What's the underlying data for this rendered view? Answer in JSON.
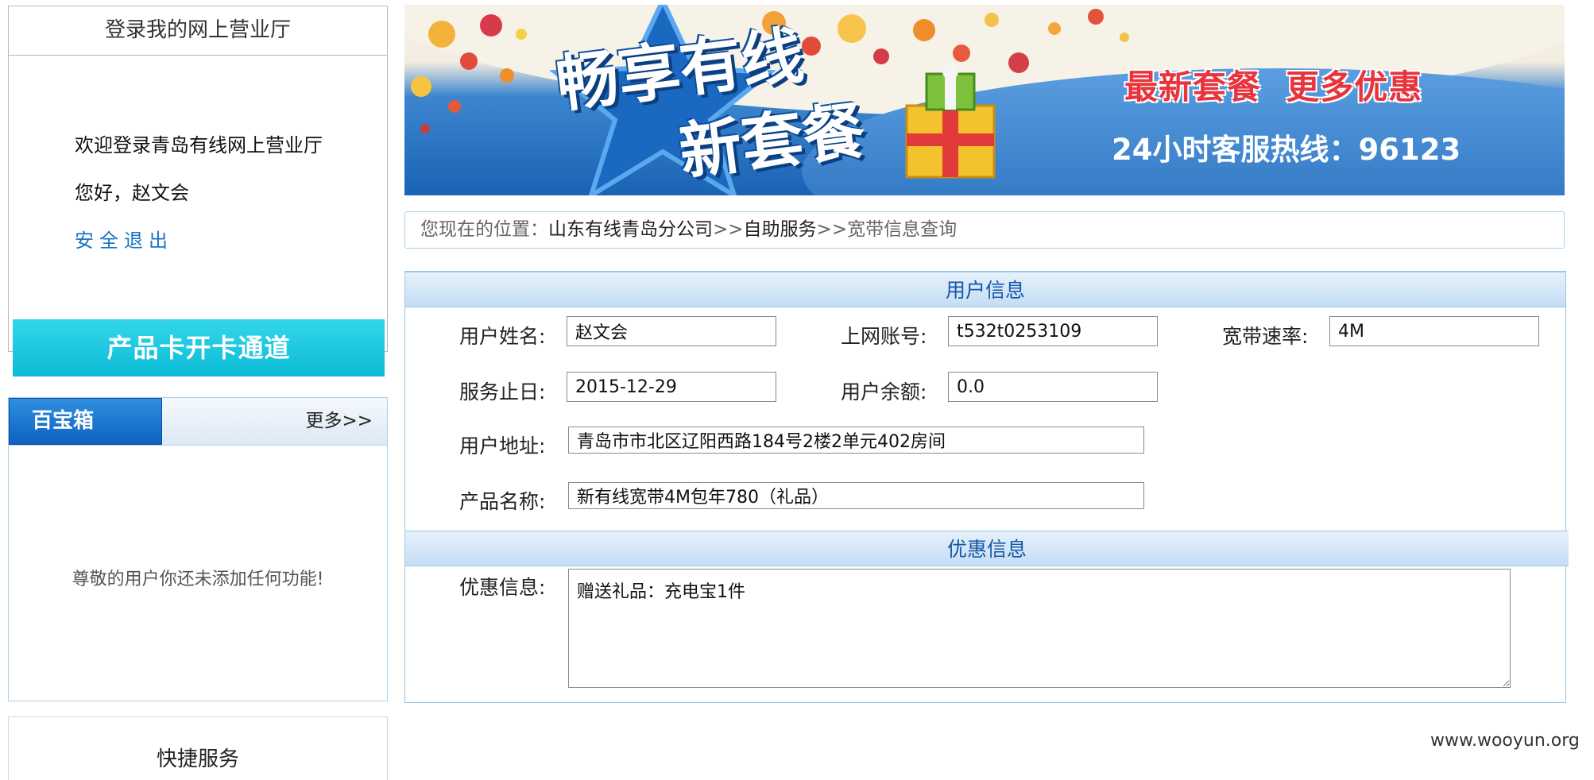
{
  "sidebar": {
    "login": {
      "title": "登录我的网上营业厅",
      "welcome": "欢迎登录青岛有线网上营业厅",
      "greeting": "您好，赵文会",
      "logout": "安全退出",
      "card_button": "产品卡开卡通道"
    },
    "toolbox": {
      "tab": "百宝箱",
      "more": "更多>>",
      "empty_message": "尊敬的用户你还未添加任何功能!"
    },
    "quick_service": {
      "title": "快捷服务"
    }
  },
  "banner": {
    "title_line1": "畅享有线",
    "title_line2": "新套餐",
    "promo": "最新套餐  更多优惠",
    "hotline": "24小时客服热线：96123"
  },
  "breadcrumb": {
    "prefix": "您现在的位置：",
    "items": [
      "山东有线青岛分公司",
      "自助服务",
      "宽带信息查询"
    ],
    "separator": ">>"
  },
  "user_info": {
    "heading": "用户信息",
    "fields": {
      "name": {
        "label": "用户姓名:",
        "value": "赵文会"
      },
      "account": {
        "label": "上网账号:",
        "value": "t532t0253109"
      },
      "speed": {
        "label": "宽带速率:",
        "value": "4M"
      },
      "expiry": {
        "label": "服务止日:",
        "value": "2015-12-29"
      },
      "balance": {
        "label": "用户余额:",
        "value": "0.0"
      },
      "address": {
        "label": "用户地址:",
        "value": "青岛市市北区辽阳西路184号2楼2单元402房间"
      },
      "product": {
        "label": "产品名称:",
        "value": "新有线宽带4M包年780（礼品）"
      }
    }
  },
  "promo_info": {
    "heading": "优惠信息",
    "label": "优惠信息:",
    "value": "赠送礼品：充电宝1件"
  },
  "watermark": "www.wooyun.org",
  "colors": {
    "accent_blue": "#1557a8",
    "link_blue": "#1a73c8",
    "cyan_button": "#0cbcd6",
    "promo_red": "#e8343c"
  }
}
